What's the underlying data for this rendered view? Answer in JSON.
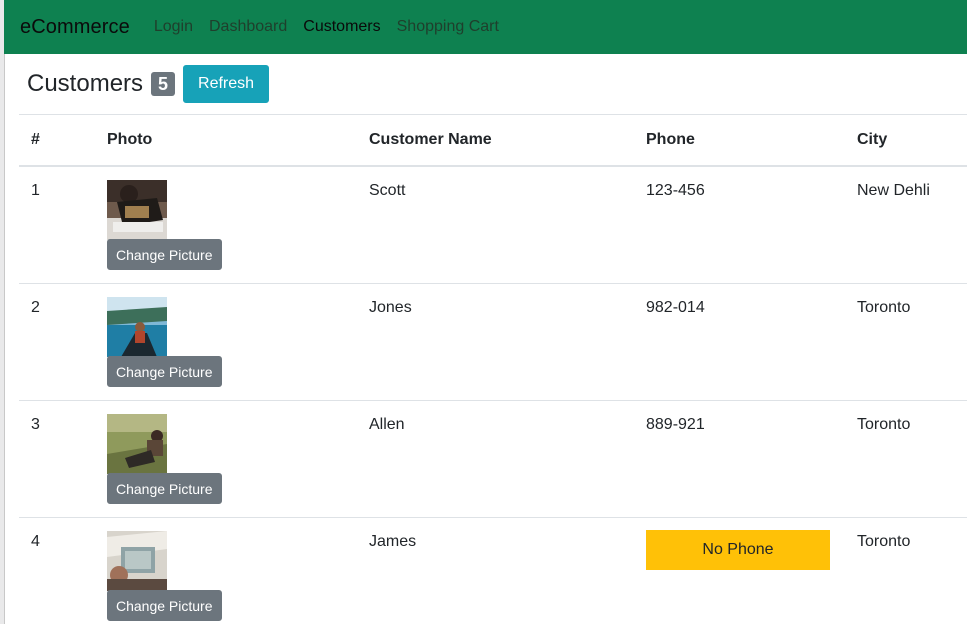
{
  "navbar": {
    "brand": "eCommerce",
    "links": [
      {
        "label": "Login"
      },
      {
        "label": "Dashboard"
      },
      {
        "label": "Customers",
        "active": true
      },
      {
        "label": "Shopping Cart"
      }
    ]
  },
  "header": {
    "title": "Customers",
    "count": "5",
    "refresh_label": "Refresh"
  },
  "table": {
    "columns": [
      "#",
      "Photo",
      "Customer Name",
      "Phone",
      "City"
    ],
    "change_picture_label": "Change Picture",
    "rows": [
      {
        "num": "1",
        "name": "Scott",
        "phone": "123-456",
        "city": "New Dehli"
      },
      {
        "num": "2",
        "name": "Jones",
        "phone": "982-014",
        "city": "Toronto"
      },
      {
        "num": "3",
        "name": "Allen",
        "phone": "889-921",
        "city": "Toronto"
      },
      {
        "num": "4",
        "name": "James",
        "phone": "No Phone",
        "city": "Toronto",
        "no_phone": true
      }
    ]
  },
  "colors": {
    "navbar_bg": "#0e8150",
    "badge": "#6c757d",
    "refresh_button": "#17a2b8",
    "change_picture_button": "#6c757d",
    "no_phone_highlight": "#ffc107"
  }
}
